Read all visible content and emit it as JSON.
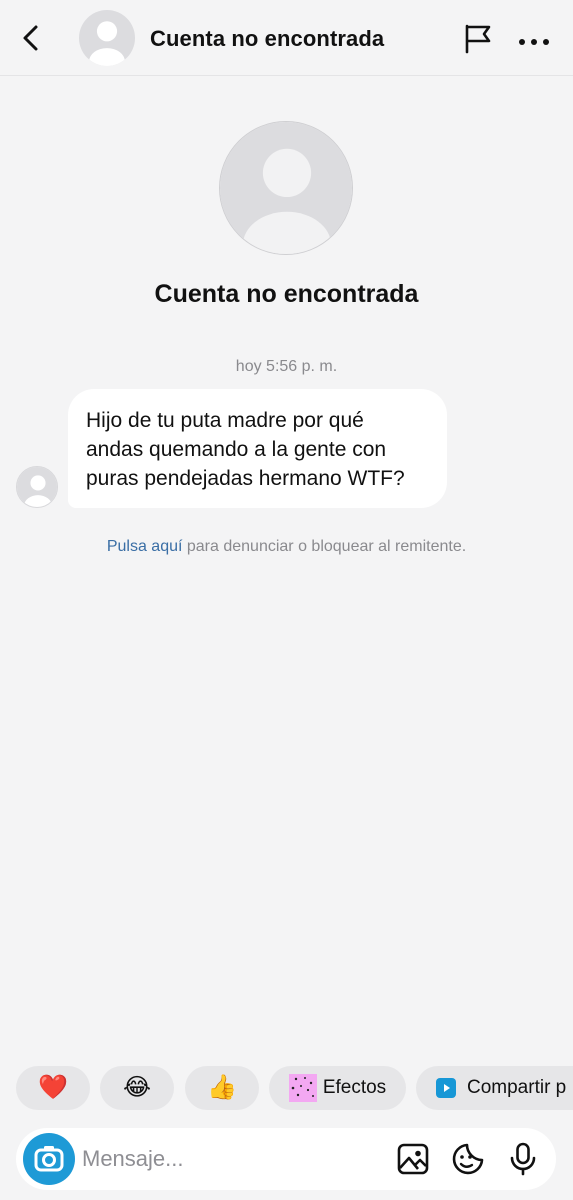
{
  "header": {
    "title": "Cuenta no encontrada",
    "back_icon": "chevron-left-icon",
    "flag_icon": "flag-icon",
    "more_icon": "more-horizontal-icon"
  },
  "profile": {
    "name": "Cuenta no encontrada",
    "avatar_icon": "default-avatar-icon"
  },
  "conversation": {
    "timestamp": "hoy 5:56 p. m.",
    "messages": [
      {
        "sender": "incoming",
        "lines": [
          "Hijo de tu puta madre por qué",
          "andas quemando a la gente con",
          "puras pendejadas hermano WTF?"
        ]
      }
    ],
    "report": {
      "link_text": "Pulsa aquí",
      "rest_text": " para denunciar o bloquear al remitente."
    }
  },
  "quick_reactions": {
    "heart": "❤️",
    "laugh": "😂",
    "thumbs_up": "👍",
    "effects_label": "Efectos",
    "share_label": "Compartir p"
  },
  "composer": {
    "placeholder": "Mensaje...",
    "camera_icon": "camera-icon",
    "gallery_icon": "gallery-icon",
    "sticker_icon": "sticker-icon",
    "mic_icon": "microphone-icon"
  },
  "colors": {
    "background": "#f4f4f5",
    "bubble": "#ffffff",
    "link": "#3a6ea5",
    "camera_button": "#1e9ad6",
    "chip": "#e6e6e8"
  }
}
